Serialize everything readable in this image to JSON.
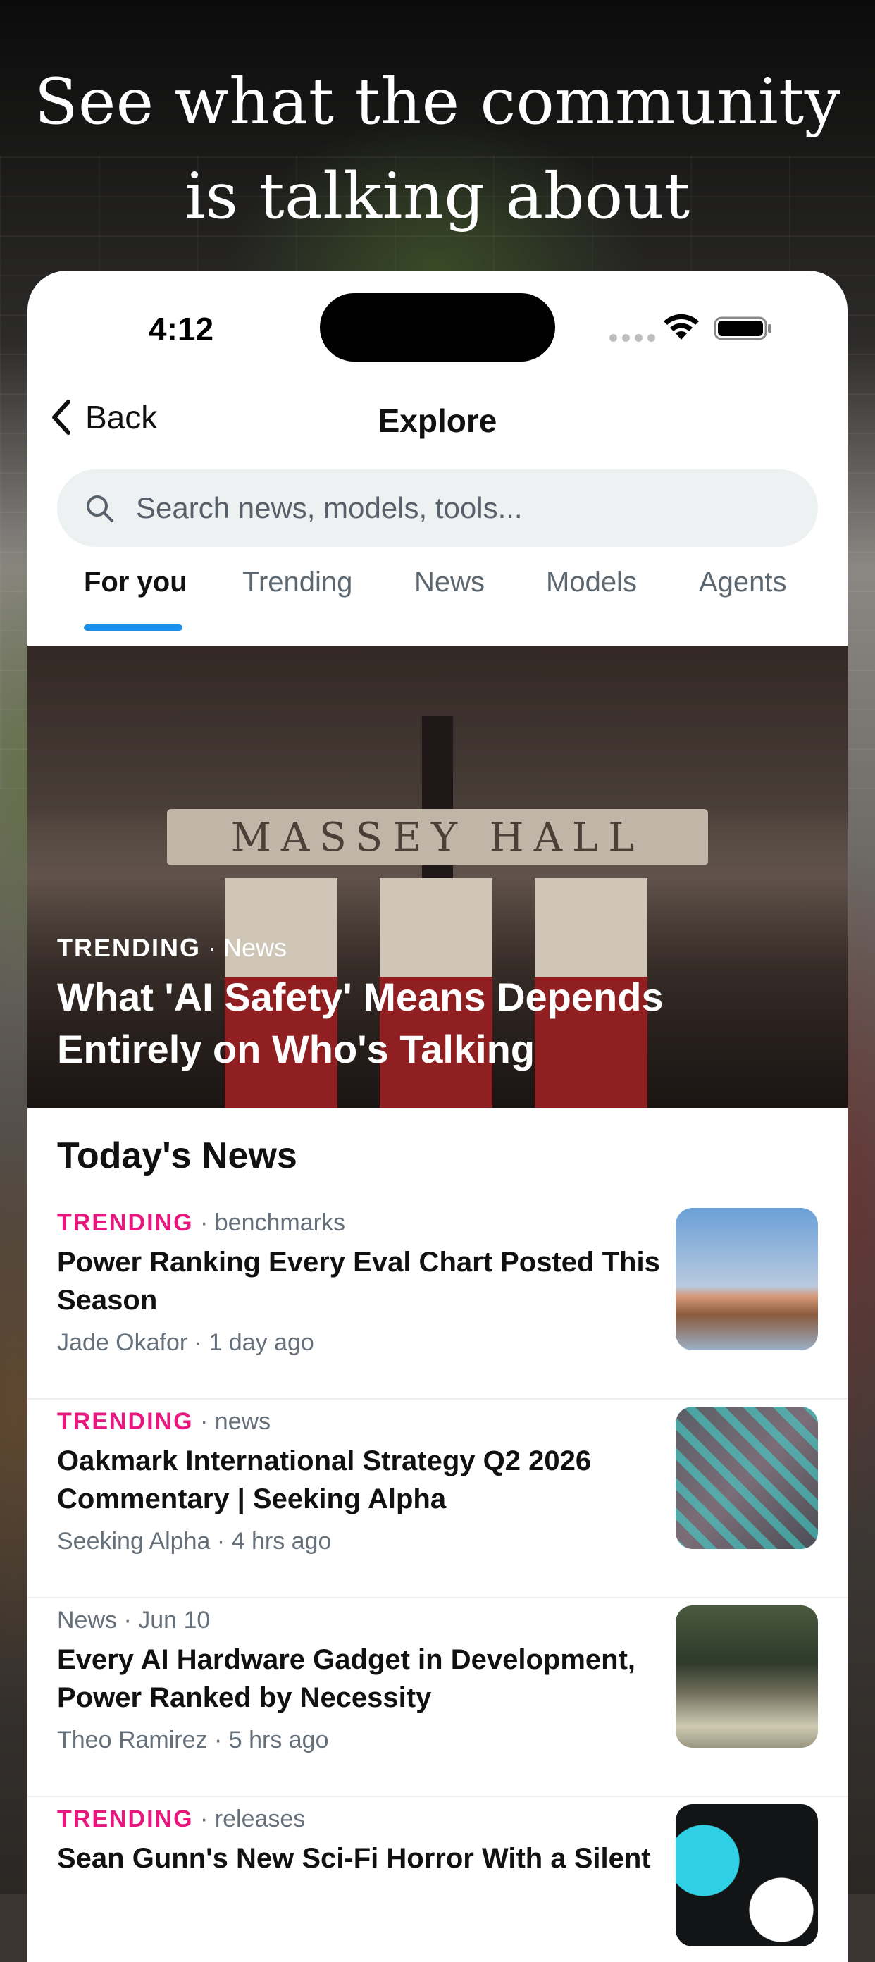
{
  "promo": {
    "headline_line1": "See what the community",
    "headline_line2": "is talking about"
  },
  "status_bar": {
    "time": "4:12"
  },
  "nav": {
    "back_label": "Back",
    "title": "Explore"
  },
  "search": {
    "placeholder": "Search news, models, tools..."
  },
  "tabs": [
    {
      "label": "For you",
      "active": true
    },
    {
      "label": "Trending",
      "active": false
    },
    {
      "label": "News",
      "active": false
    },
    {
      "label": "Models",
      "active": false
    },
    {
      "label": "Agents",
      "active": false
    }
  ],
  "hero": {
    "kicker": "TRENDING",
    "category": "· News",
    "title": "What 'AI Safety' Means Depends Entirely on Who's Talking",
    "sign_text": "MASSEY HALL"
  },
  "section": {
    "title": "Today's News"
  },
  "news": [
    {
      "tag": "TRENDING",
      "category": "· benchmarks",
      "title": "Power Ranking Every Eval Chart Posted This Season",
      "byline": "Jade Okafor · 1 day ago"
    },
    {
      "tag": "TRENDING",
      "category": "· news",
      "title": "Oakmark International Strategy Q2 2026 Commentary | Seeking Alpha",
      "byline": "Seeking Alpha · 4 hrs ago"
    },
    {
      "tag": "",
      "category": "News · Jun 10",
      "title": "Every AI Hardware Gadget in Development, Power Ranked by Necessity",
      "byline": "Theo Ramirez · 5 hrs ago"
    },
    {
      "tag": "TRENDING",
      "category": "· releases",
      "title": "Sean Gunn's New Sci-Fi Horror With a Silent",
      "byline": ""
    }
  ],
  "colors": {
    "accent": "#1d8fe6",
    "trending": "#e8177e"
  }
}
